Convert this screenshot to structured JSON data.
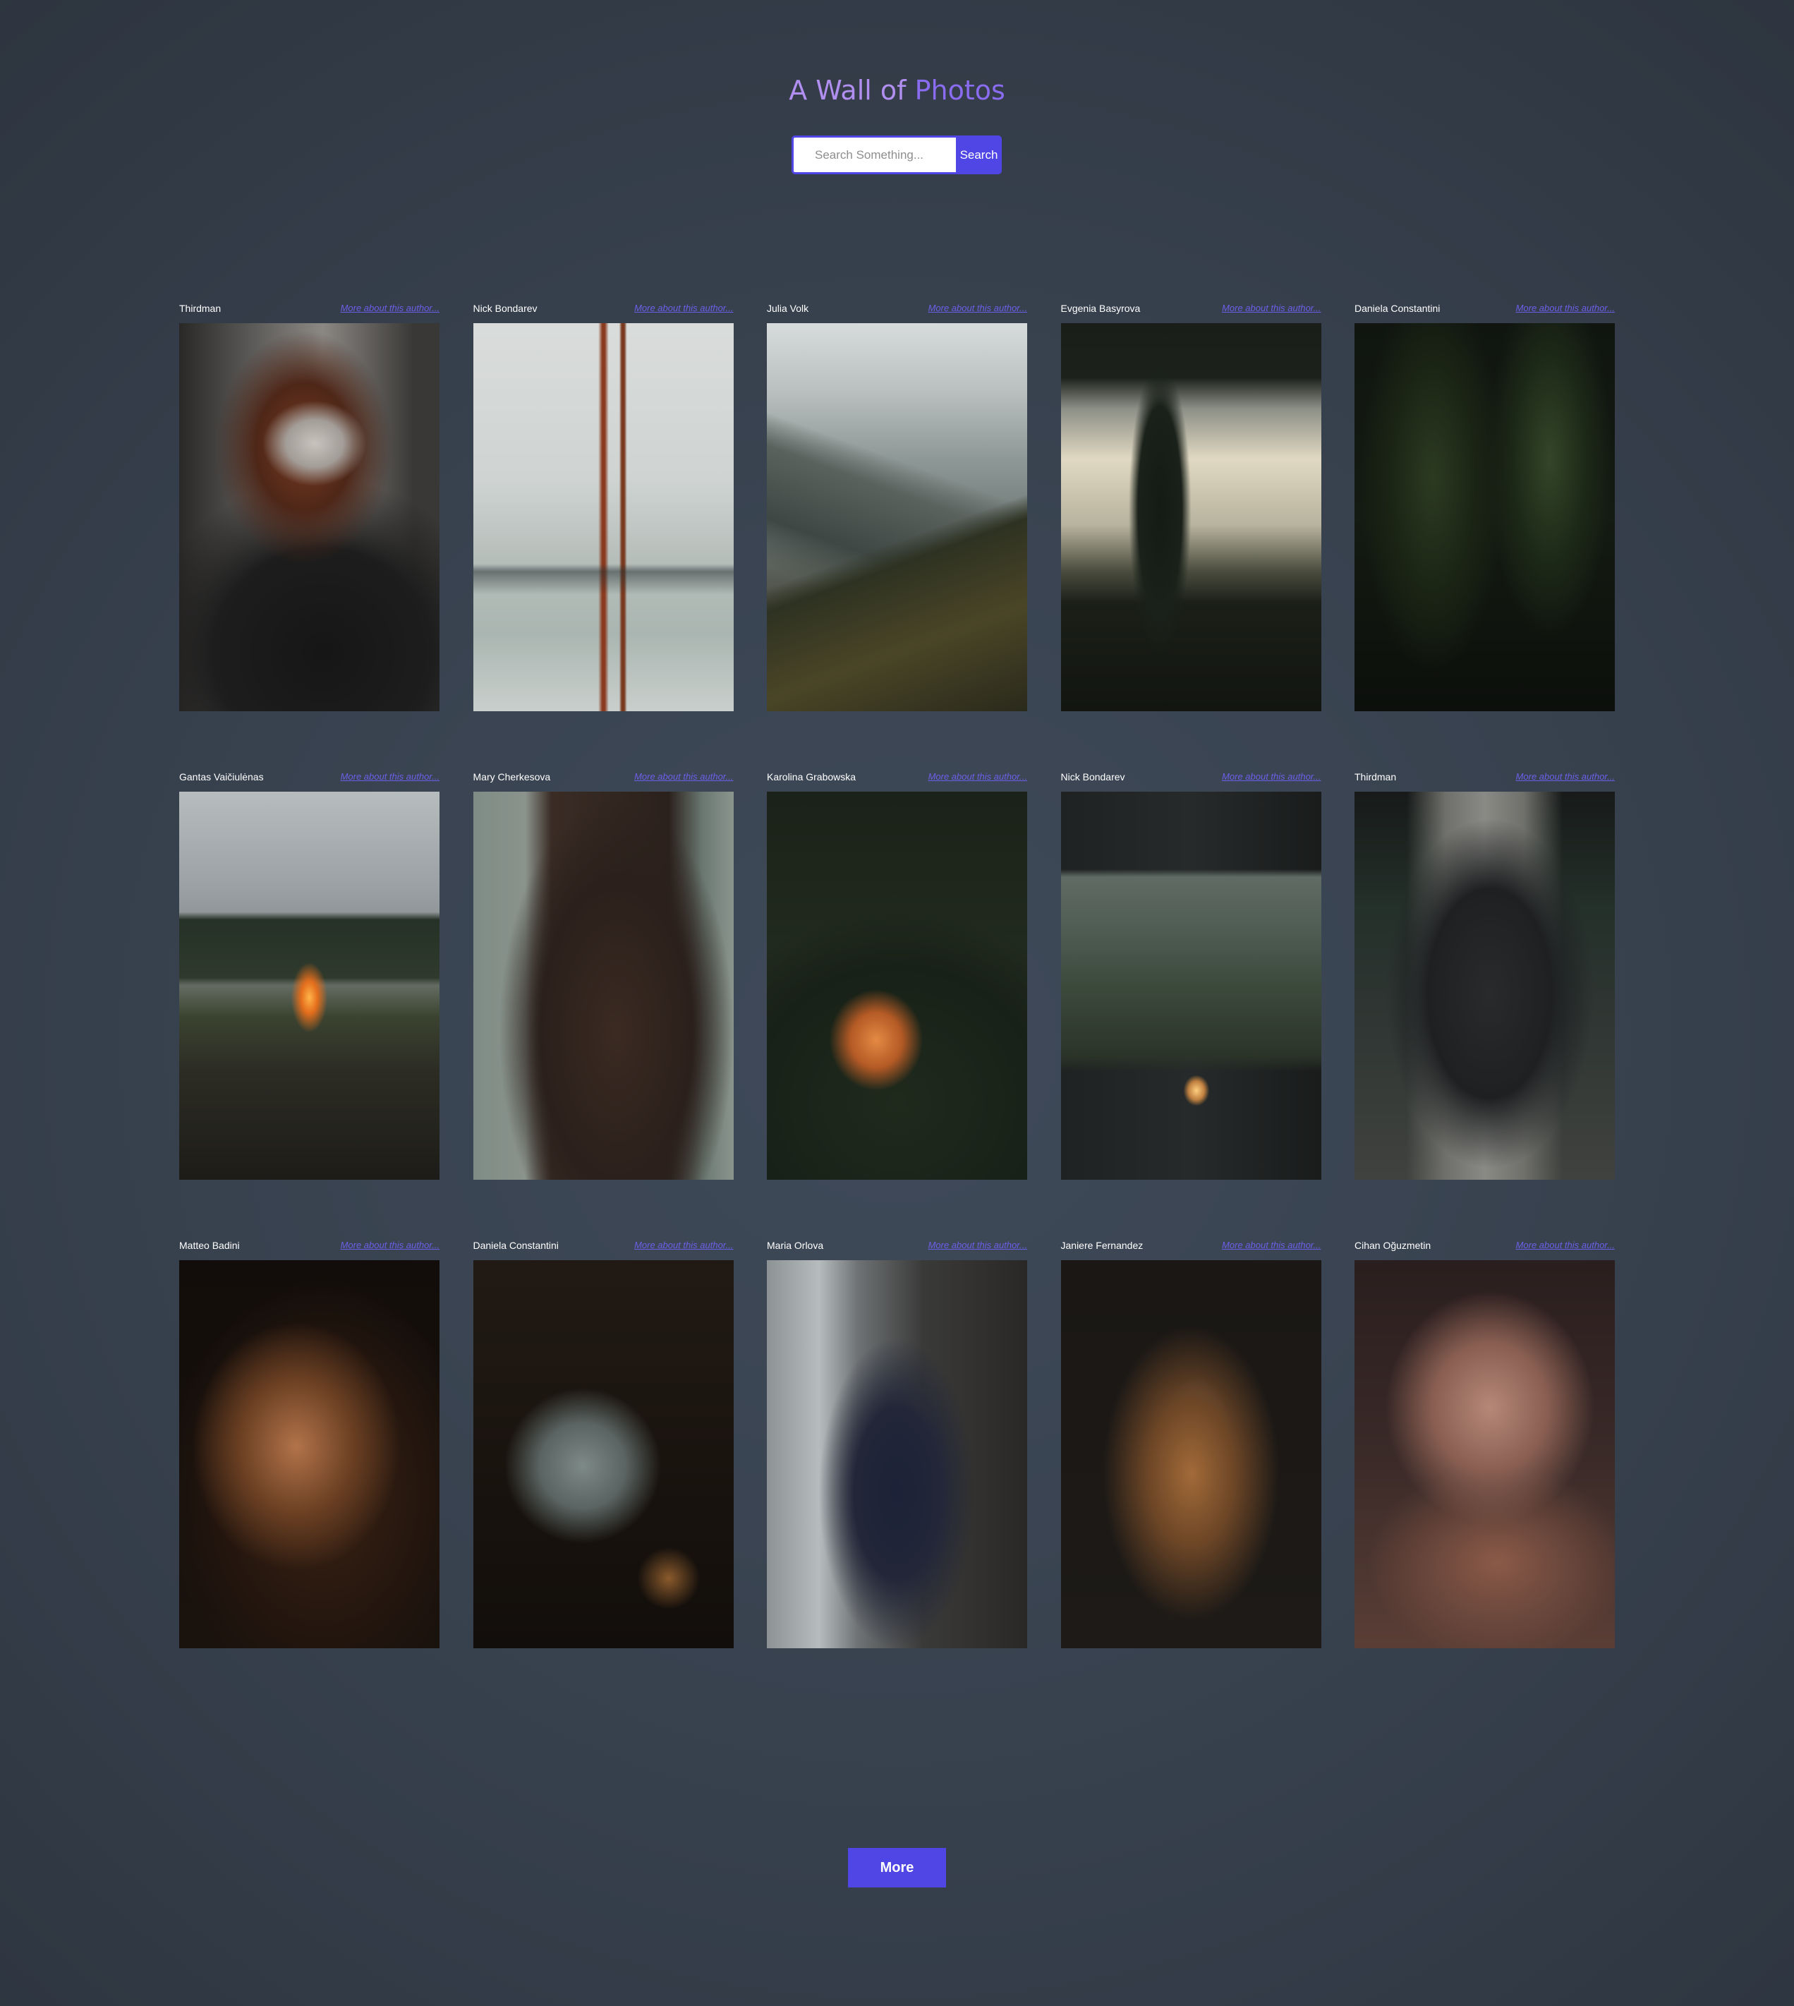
{
  "header": {
    "title_part1": "A Wall of ",
    "title_part2": "Photos"
  },
  "search": {
    "placeholder": "Search Something...",
    "value": "",
    "button_label": "Search"
  },
  "photos": [
    {
      "author": "Thirdman",
      "link_text": "More about this author..."
    },
    {
      "author": "Nick Bondarev",
      "link_text": "More about this author..."
    },
    {
      "author": "Julia Volk",
      "link_text": "More about this author..."
    },
    {
      "author": "Evgenia Basyrova",
      "link_text": "More about this author..."
    },
    {
      "author": "Daniela Constantini",
      "link_text": "More about this author..."
    },
    {
      "author": "Gantas Vaičiulėnas",
      "link_text": "More about this author..."
    },
    {
      "author": "Mary Cherkesova",
      "link_text": "More about this author..."
    },
    {
      "author": "Karolina Grabowska",
      "link_text": "More about this author..."
    },
    {
      "author": "Nick Bondarev",
      "link_text": "More about this author..."
    },
    {
      "author": "Thirdman",
      "link_text": "More about this author..."
    },
    {
      "author": "Matteo Badini",
      "link_text": "More about this author..."
    },
    {
      "author": "Daniela Constantini",
      "link_text": "More about this author..."
    },
    {
      "author": "Maria Orlova",
      "link_text": "More about this author..."
    },
    {
      "author": "Janiere Fernandez",
      "link_text": "More about this author..."
    },
    {
      "author": "Cihan Oğuzmetin",
      "link_text": "More about this author..."
    }
  ],
  "pagination": {
    "more_label": "More"
  },
  "colors": {
    "accent": "#4f46e5",
    "title_light": "#b18ff0",
    "title_dark": "#8a6cf0",
    "background": "#3a4452",
    "author_text": "#ffffff",
    "link_text": "#6b5fe8"
  }
}
